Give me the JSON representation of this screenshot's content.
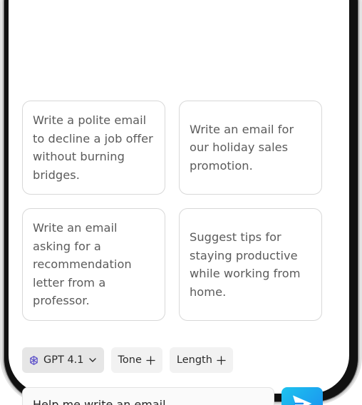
{
  "suggestions": [
    {
      "text": "Write a polite email to decline a job offer without burning bridges."
    },
    {
      "text": "Write an email for our holiday sales promotion."
    },
    {
      "text": "Write an email asking for a recommendation letter from a professor."
    },
    {
      "text": "Suggest tips for staying productive while working from home."
    }
  ],
  "toolbar": {
    "model_label": "GPT 4.1",
    "model_icon": "openai-logo-icon",
    "model_chevron_icon": "chevron-down-icon",
    "tone_label": "Tone",
    "length_label": "Length",
    "add_icon": "plus-icon"
  },
  "composer": {
    "input_value": "Help me write an email",
    "send_icon": "send-icon"
  },
  "colors": {
    "accent_start": "#1ec3ee",
    "accent_end": "#1a8df0",
    "model_icon_color": "#5b4fc9"
  }
}
